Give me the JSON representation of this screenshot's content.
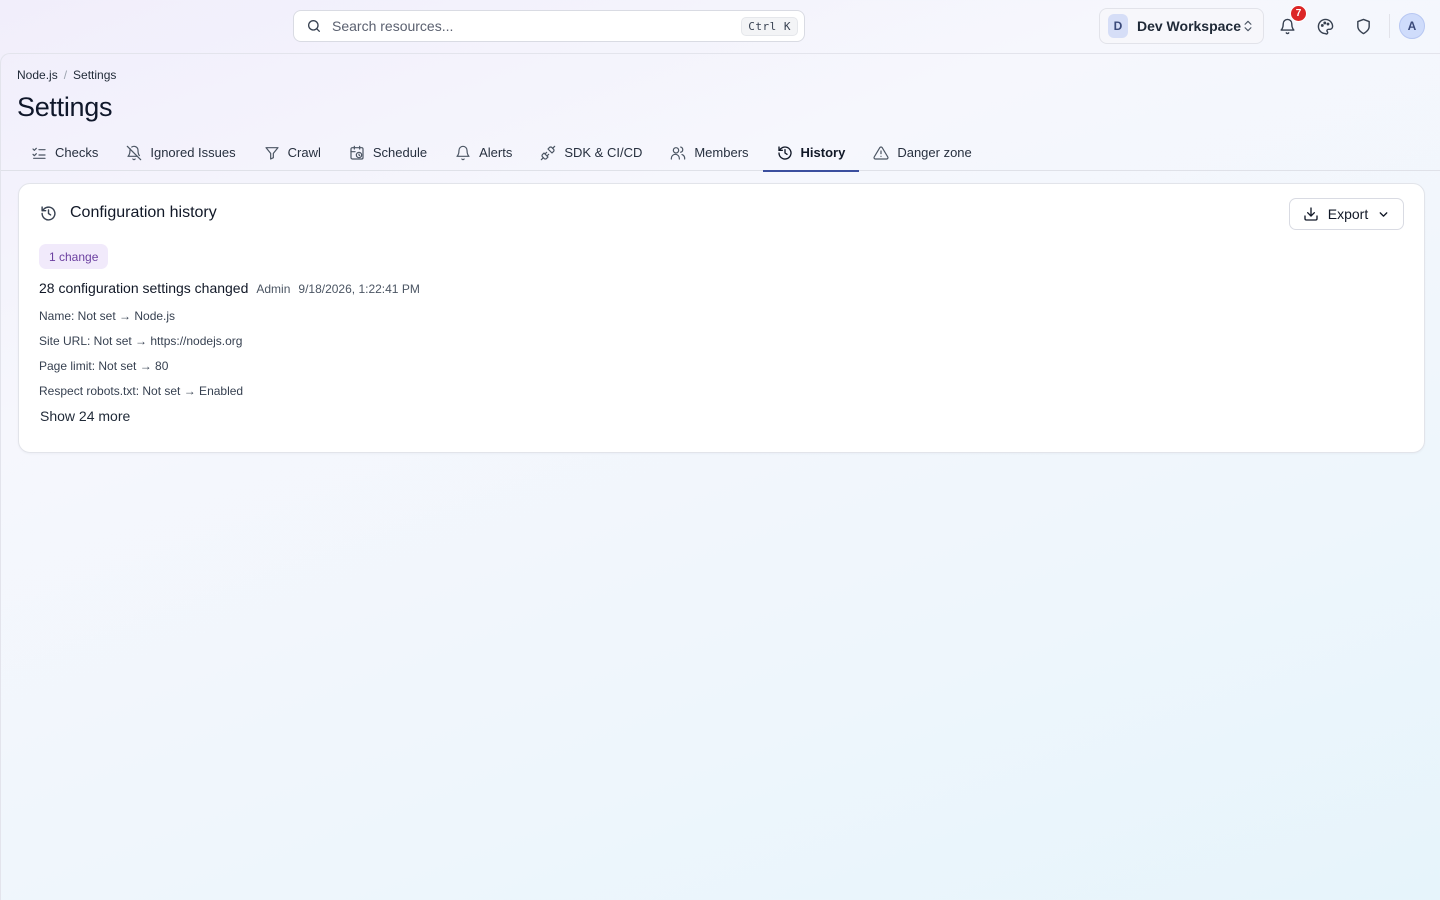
{
  "search": {
    "placeholder": "Search resources...",
    "shortcut": "Ctrl K"
  },
  "workspace": {
    "initial": "D",
    "name": "Dev Workspace"
  },
  "notifications": {
    "count": "7"
  },
  "user": {
    "initial": "A"
  },
  "breadcrumb": {
    "items": [
      "Node.js",
      "Settings"
    ],
    "separator": "/"
  },
  "page": {
    "title": "Settings"
  },
  "tabs": [
    {
      "label": "Checks",
      "icon": "checklist-icon"
    },
    {
      "label": "Ignored Issues",
      "icon": "bell-off-icon"
    },
    {
      "label": "Crawl",
      "icon": "filter-icon"
    },
    {
      "label": "Schedule",
      "icon": "calendar-clock-icon"
    },
    {
      "label": "Alerts",
      "icon": "bell-icon"
    },
    {
      "label": "SDK & CI/CD",
      "icon": "plug-icon"
    },
    {
      "label": "Members",
      "icon": "users-icon"
    },
    {
      "label": "History",
      "icon": "history-icon",
      "active": true
    },
    {
      "label": "Danger zone",
      "icon": "warning-icon"
    }
  ],
  "history": {
    "title": "Configuration history",
    "export_label": "Export",
    "badge": "1 change",
    "entry": {
      "title": "28 configuration settings changed",
      "author": "Admin",
      "timestamp": "9/18/2026, 1:22:41 PM",
      "changes": [
        "Name: Not set → Node.js",
        "Site URL: Not set → https://nodejs.org",
        "Page limit: Not set → 80",
        "Respect robots.txt: Not set → Enabled"
      ],
      "show_more": "Show 24 more"
    }
  },
  "colors": {
    "accent": "#3b4f9e",
    "notification": "#dc2626",
    "badge_bg": "#f1eafb",
    "badge_text": "#6b3fa0"
  }
}
